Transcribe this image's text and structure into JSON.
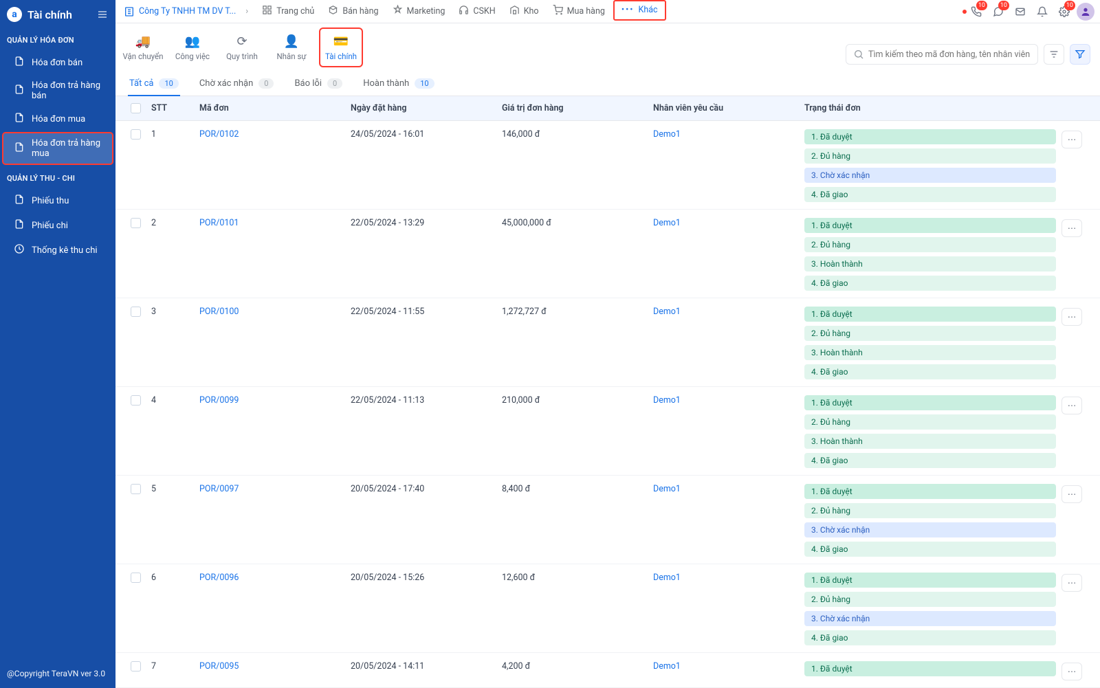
{
  "sidebar": {
    "title": "Tài chính",
    "sections": [
      {
        "label": "QUẢN LÝ HÓA ĐƠN",
        "items": [
          {
            "label": "Hóa đơn bán",
            "icon": "document-icon"
          },
          {
            "label": "Hóa đơn trả hàng bán",
            "icon": "document-icon"
          },
          {
            "label": "Hóa đơn mua",
            "icon": "document-icon"
          },
          {
            "label": "Hóa đơn trả hàng mua",
            "icon": "document-icon",
            "active": true,
            "highlighted": true
          }
        ]
      },
      {
        "label": "QUẢN LÝ THU - CHI",
        "items": [
          {
            "label": "Phiếu thu",
            "icon": "document-icon"
          },
          {
            "label": "Phiếu chi",
            "icon": "document-icon"
          },
          {
            "label": "Thống kê thu chi",
            "icon": "clock-icon"
          }
        ]
      }
    ],
    "footer": "@Copyright TeraVN ver 3.0"
  },
  "topbar": {
    "company": "Công Ty TNHH TM DV T...",
    "nav": [
      {
        "label": "Trang chủ"
      },
      {
        "label": "Bán hàng"
      },
      {
        "label": "Marketing"
      },
      {
        "label": "CSKH"
      },
      {
        "label": "Kho"
      },
      {
        "label": "Mua hàng"
      },
      {
        "label": "Khác",
        "highlighted": true
      }
    ],
    "icon_badges": {
      "phone": "10",
      "chat": "10",
      "mail": "",
      "bell": "",
      "settings": "10"
    }
  },
  "subnav": {
    "items": [
      {
        "label": "Vận chuyển"
      },
      {
        "label": "Công việc"
      },
      {
        "label": "Quy trình"
      },
      {
        "label": "Nhân sự"
      },
      {
        "label": "Tài chính",
        "active": true,
        "highlighted": true
      }
    ],
    "search_placeholder": "Tìm kiếm theo mã đơn hàng, tên nhân viên"
  },
  "tabs": [
    {
      "label": "Tất cả",
      "count": "10",
      "active": true,
      "style": "blue"
    },
    {
      "label": "Chờ xác nhận",
      "count": "0",
      "style": "gray"
    },
    {
      "label": "Báo lỗi",
      "count": "0",
      "style": "gray"
    },
    {
      "label": "Hoàn thành",
      "count": "10",
      "style": "blue"
    }
  ],
  "table": {
    "columns": [
      "STT",
      "Mã đơn",
      "Ngày đặt hàng",
      "Giá trị đơn hàng",
      "Nhân viên yêu cầu",
      "Trạng thái đơn"
    ],
    "rows": [
      {
        "stt": "1",
        "code": "POR/0102",
        "date": "24/05/2024 - 16:01",
        "value": "146,000 đ",
        "emp": "Demo1",
        "statuses": [
          {
            "t": "1. Đã duyệt",
            "c": "st-green"
          },
          {
            "t": "2. Đủ hàng",
            "c": "st-ltgreen"
          },
          {
            "t": "3. Chờ xác nhận",
            "c": "st-blue"
          },
          {
            "t": "4. Đã giao",
            "c": "st-ltgreen"
          }
        ]
      },
      {
        "stt": "2",
        "code": "POR/0101",
        "date": "22/05/2024 - 13:29",
        "value": "45,000,000 đ",
        "emp": "Demo1",
        "statuses": [
          {
            "t": "1. Đã duyệt",
            "c": "st-green"
          },
          {
            "t": "2. Đủ hàng",
            "c": "st-ltgreen"
          },
          {
            "t": "3. Hoàn thành",
            "c": "st-ltgreen"
          },
          {
            "t": "4. Đã giao",
            "c": "st-ltgreen"
          }
        ]
      },
      {
        "stt": "3",
        "code": "POR/0100",
        "date": "22/05/2024 - 11:55",
        "value": "1,272,727 đ",
        "emp": "Demo1",
        "statuses": [
          {
            "t": "1. Đã duyệt",
            "c": "st-green"
          },
          {
            "t": "2. Đủ hàng",
            "c": "st-ltgreen"
          },
          {
            "t": "3. Hoàn thành",
            "c": "st-ltgreen"
          },
          {
            "t": "4. Đã giao",
            "c": "st-ltgreen"
          }
        ]
      },
      {
        "stt": "4",
        "code": "POR/0099",
        "date": "22/05/2024 - 11:13",
        "value": "210,000 đ",
        "emp": "Demo1",
        "statuses": [
          {
            "t": "1. Đã duyệt",
            "c": "st-green"
          },
          {
            "t": "2. Đủ hàng",
            "c": "st-ltgreen"
          },
          {
            "t": "3. Hoàn thành",
            "c": "st-ltgreen"
          },
          {
            "t": "4. Đã giao",
            "c": "st-ltgreen"
          }
        ]
      },
      {
        "stt": "5",
        "code": "POR/0097",
        "date": "20/05/2024 - 17:40",
        "value": "8,400 đ",
        "emp": "Demo1",
        "statuses": [
          {
            "t": "1. Đã duyệt",
            "c": "st-green"
          },
          {
            "t": "2. Đủ hàng",
            "c": "st-ltgreen"
          },
          {
            "t": "3. Chờ xác nhận",
            "c": "st-blue"
          },
          {
            "t": "4. Đã giao",
            "c": "st-ltgreen"
          }
        ]
      },
      {
        "stt": "6",
        "code": "POR/0096",
        "date": "20/05/2024 - 15:26",
        "value": "12,600 đ",
        "emp": "Demo1",
        "statuses": [
          {
            "t": "1. Đã duyệt",
            "c": "st-green"
          },
          {
            "t": "2. Đủ hàng",
            "c": "st-ltgreen"
          },
          {
            "t": "3. Chờ xác nhận",
            "c": "st-blue"
          },
          {
            "t": "4. Đã giao",
            "c": "st-ltgreen"
          }
        ]
      },
      {
        "stt": "7",
        "code": "POR/0095",
        "date": "20/05/2024 - 14:11",
        "value": "4,200 đ",
        "emp": "Demo1",
        "statuses": [
          {
            "t": "1. Đã duyệt",
            "c": "st-green"
          }
        ]
      }
    ]
  }
}
